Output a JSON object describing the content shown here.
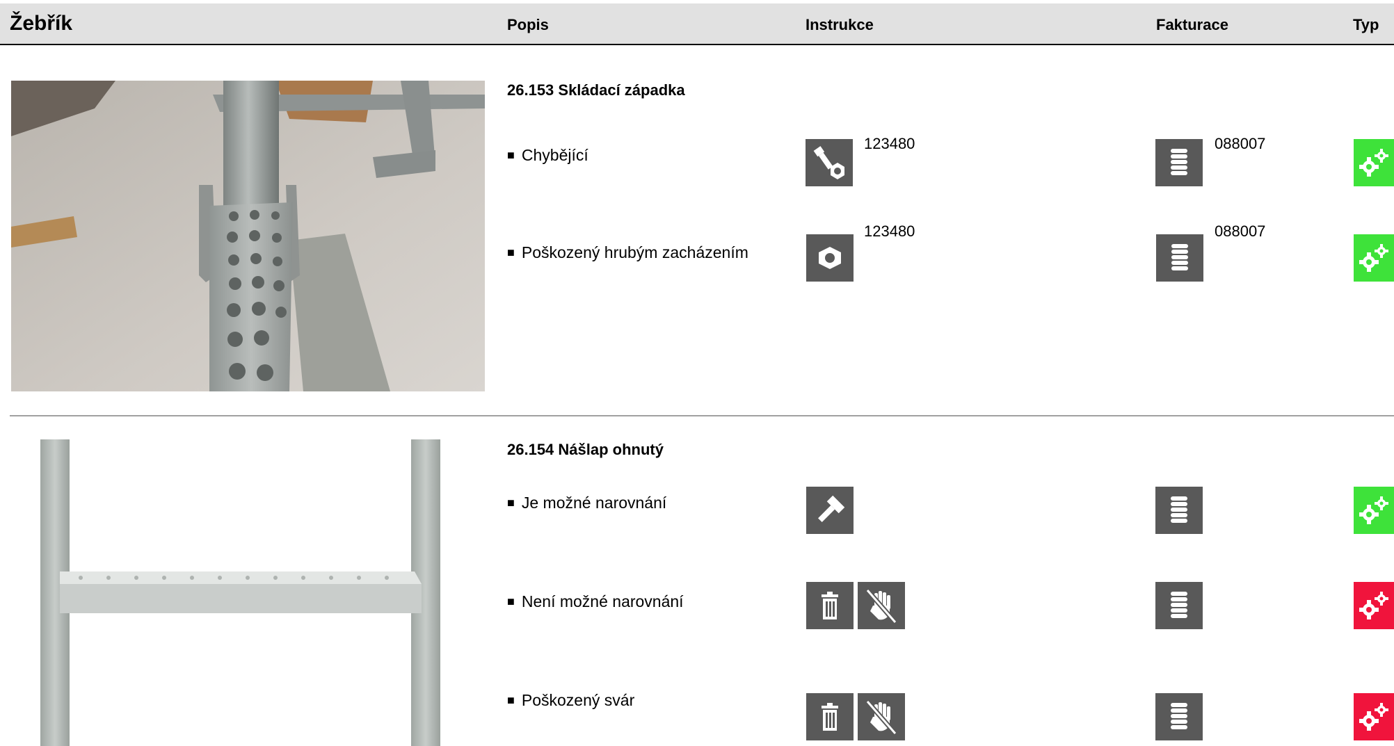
{
  "header": {
    "title": "Žebřík",
    "col_popis": "Popis",
    "col_instrukce": "Instrukce",
    "col_fakturace": "Fakturace",
    "col_typ": "Typ"
  },
  "groups": [
    {
      "title": "26.153 Skládací západka",
      "items": [
        {
          "label": "Chybějící",
          "instr_code": "123480",
          "fakt_code": "088007",
          "instr_icons": [
            "bolt-nut-icon"
          ],
          "fakt_icon": "coin-stack-icon",
          "typ": "green"
        },
        {
          "label": "Poškozený hrubým zacházením",
          "instr_code": "123480",
          "fakt_code": "088007",
          "instr_icons": [
            "hex-nut-icon"
          ],
          "fakt_icon": "coin-stack-icon",
          "typ": "green"
        }
      ]
    },
    {
      "title": "26.154 Nášlap ohnutý",
      "items": [
        {
          "label": "Je možné narovnání",
          "instr_icons": [
            "hammer-icon"
          ],
          "fakt_icon": "coin-stack-icon",
          "typ": "green"
        },
        {
          "label": "Není možné narovnání",
          "instr_icons": [
            "trash-icon",
            "no-hand-icon"
          ],
          "fakt_icon": "coin-stack-icon",
          "typ": "red"
        },
        {
          "label": "Poškozený svár",
          "instr_icons": [
            "trash-icon",
            "no-hand-icon"
          ],
          "fakt_icon": "coin-stack-icon",
          "typ": "red"
        }
      ]
    }
  ],
  "colors": {
    "icon_bg": "#595959",
    "typ_green": "#3ee23a",
    "typ_red": "#f0143c",
    "header_bg": "#e1e1e1"
  }
}
